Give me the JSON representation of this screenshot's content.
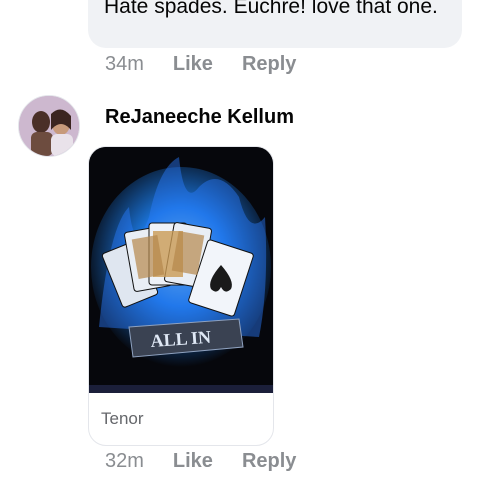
{
  "previous_comment": {
    "text": "Hate spades. Euchre! love that one.",
    "time": "34m",
    "like_label": "Like",
    "reply_label": "Reply"
  },
  "comment": {
    "author": "ReJaneeche Kellum",
    "gif": {
      "caption": "ALL IN",
      "source": "Tenor"
    },
    "time": "32m",
    "like_label": "Like",
    "reply_label": "Reply"
  },
  "colors": {
    "bubble_bg": "#f0f2f5",
    "meta_text": "#8a8d91",
    "flame_blue": "#3fa8ff"
  },
  "icons": [
    "avatar-photo",
    "gif-image"
  ]
}
